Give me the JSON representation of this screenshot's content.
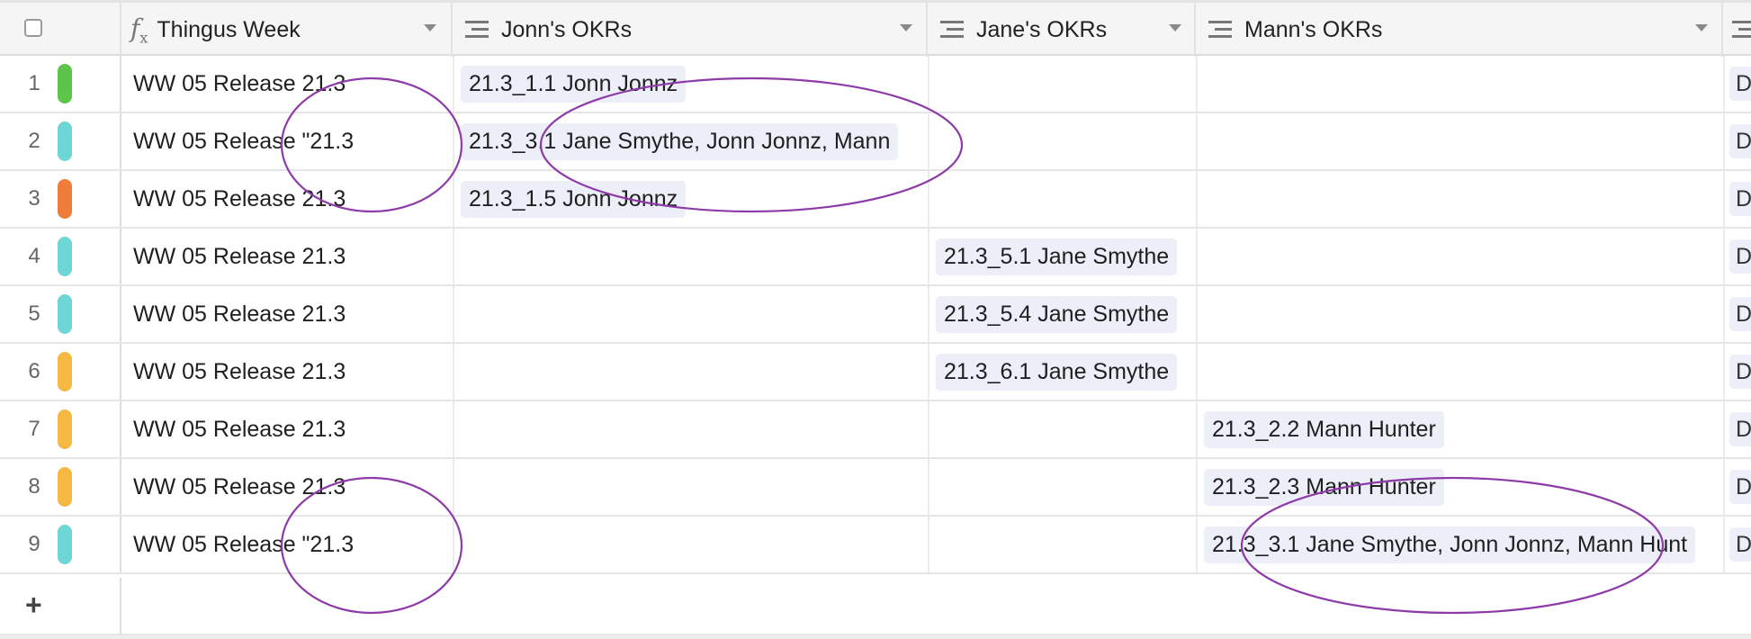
{
  "header": {
    "columns": [
      {
        "label": "Thingus Week",
        "icon": "formula-icon"
      },
      {
        "label": "Jonn's OKRs",
        "icon": "lookup-lines-icon"
      },
      {
        "label": "Jane's OKRs",
        "icon": "lookup-lines-icon"
      },
      {
        "label": "Mann's OKRs",
        "icon": "lookup-lines-icon"
      }
    ]
  },
  "colors": {
    "green": "#5cc54a",
    "teal": "#6ed6d6",
    "orange": "#f07c3c",
    "yellow": "#f5b944",
    "annotation": "#8e3aa8",
    "chip": "#eceef8"
  },
  "rows": [
    {
      "num": "1",
      "color": "#5cc54a",
      "week": "WW 05 Release 21.3",
      "jonn": "21.3_1.1 Jonn Jonnz",
      "jane": "",
      "mann": "",
      "stub": "D"
    },
    {
      "num": "2",
      "color": "#6ed6d6",
      "week": "WW 05 Release \"21.3",
      "jonn": "21.3_3.1 Jane Smythe, Jonn Jonnz, Mann",
      "jane": "",
      "mann": "",
      "stub": "D"
    },
    {
      "num": "3",
      "color": "#f07c3c",
      "week": "WW 05 Release 21.3",
      "jonn": "21.3_1.5 Jonn Jonnz",
      "jane": "",
      "mann": "",
      "stub": "D"
    },
    {
      "num": "4",
      "color": "#6ed6d6",
      "week": "WW 05 Release 21.3",
      "jonn": "",
      "jane": "21.3_5.1 Jane Smythe",
      "mann": "",
      "stub": "D"
    },
    {
      "num": "5",
      "color": "#6ed6d6",
      "week": "WW 05 Release 21.3",
      "jonn": "",
      "jane": "21.3_5.4 Jane Smythe",
      "mann": "",
      "stub": "D"
    },
    {
      "num": "6",
      "color": "#f5b944",
      "week": "WW 05 Release 21.3",
      "jonn": "",
      "jane": "21.3_6.1 Jane Smythe",
      "mann": "",
      "stub": "D"
    },
    {
      "num": "7",
      "color": "#f5b944",
      "week": "WW 05 Release 21.3",
      "jonn": "",
      "jane": "",
      "mann": "21.3_2.2 Mann Hunter",
      "stub": "D"
    },
    {
      "num": "8",
      "color": "#f5b944",
      "week": "WW 05 Release 21.3",
      "jonn": "",
      "jane": "",
      "mann": "21.3_2.3 Mann Hunter",
      "stub": "D"
    },
    {
      "num": "9",
      "color": "#6ed6d6",
      "week": "WW 05 Release \"21.3",
      "jonn": "",
      "jane": "",
      "mann": "21.3_3.1 Jane Smythe, Jonn Jonnz, Mann Hunt",
      "stub": "D"
    }
  ],
  "add_row": {
    "symbol": "+"
  }
}
